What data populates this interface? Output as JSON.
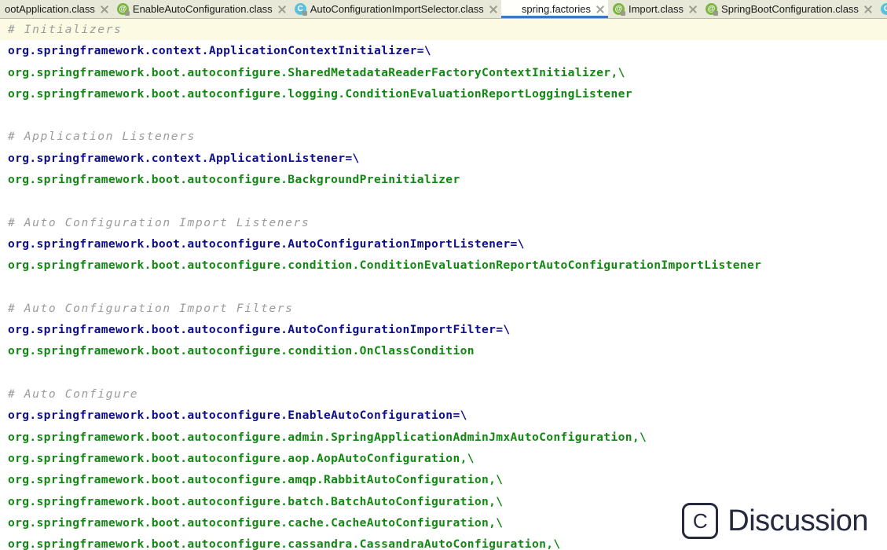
{
  "tabs": [
    {
      "label": "ootApplication.class",
      "icon": "annotation-icon",
      "icon_kind": "anno",
      "active": false,
      "truncated_left": true,
      "close_label": "×"
    },
    {
      "label": "EnableAutoConfiguration.class",
      "icon": "annotation-icon",
      "icon_kind": "anno",
      "active": false,
      "close_label": "×"
    },
    {
      "label": "AutoConfigurationImportSelector.class",
      "icon": "class-icon",
      "icon_kind": "class",
      "active": false,
      "close_label": "×"
    },
    {
      "label": "spring.factories",
      "icon": "spring-leaf-icon",
      "icon_kind": "leaf",
      "active": true,
      "close_label": "×"
    },
    {
      "label": "Import.class",
      "icon": "annotation-icon",
      "icon_kind": "anno",
      "active": false,
      "close_label": "×"
    },
    {
      "label": "SpringBootConfiguration.class",
      "icon": "annotation-icon",
      "icon_kind": "anno",
      "active": false,
      "close_label": "×"
    }
  ],
  "tab_icon_glyphs": {
    "anno": "@",
    "class": "C"
  },
  "colors": {
    "tabbar_background": "#e8e8d8",
    "active_tab_background": "#fffffb",
    "active_tab_underline": "#3b78c4",
    "editor_background": "#ffffff",
    "current_line_highlight": "#fcfae2",
    "comment": "#9b9b9b",
    "property_key": "#0e0e8c",
    "property_value": "#118811",
    "watermark": "#252a3d"
  },
  "editor": {
    "file_name": "spring.factories",
    "caret_line": 1,
    "caret_column": 1,
    "lines": [
      {
        "type": "comment",
        "text": "# Initializers",
        "highlight": true
      },
      {
        "type": "key",
        "text": "org.springframework.context.ApplicationContextInitializer=\\"
      },
      {
        "type": "value",
        "text": "org.springframework.boot.autoconfigure.SharedMetadataReaderFactoryContextInitializer,\\"
      },
      {
        "type": "value",
        "text": "org.springframework.boot.autoconfigure.logging.ConditionEvaluationReportLoggingListener"
      },
      {
        "type": "blank",
        "text": ""
      },
      {
        "type": "comment",
        "text": "# Application Listeners"
      },
      {
        "type": "key",
        "text": "org.springframework.context.ApplicationListener=\\"
      },
      {
        "type": "value",
        "text": "org.springframework.boot.autoconfigure.BackgroundPreinitializer"
      },
      {
        "type": "blank",
        "text": ""
      },
      {
        "type": "comment",
        "text": "# Auto Configuration Import Listeners"
      },
      {
        "type": "key",
        "text": "org.springframework.boot.autoconfigure.AutoConfigurationImportListener=\\"
      },
      {
        "type": "value",
        "text": "org.springframework.boot.autoconfigure.condition.ConditionEvaluationReportAutoConfigurationImportListener"
      },
      {
        "type": "blank",
        "text": ""
      },
      {
        "type": "comment",
        "text": "# Auto Configuration Import Filters"
      },
      {
        "type": "key",
        "text": "org.springframework.boot.autoconfigure.AutoConfigurationImportFilter=\\"
      },
      {
        "type": "value",
        "text": "org.springframework.boot.autoconfigure.condition.OnClassCondition"
      },
      {
        "type": "blank",
        "text": ""
      },
      {
        "type": "comment",
        "text": "# Auto Configure"
      },
      {
        "type": "key",
        "text": "org.springframework.boot.autoconfigure.EnableAutoConfiguration=\\"
      },
      {
        "type": "value",
        "text": "org.springframework.boot.autoconfigure.admin.SpringApplicationAdminJmxAutoConfiguration,\\"
      },
      {
        "type": "value",
        "text": "org.springframework.boot.autoconfigure.aop.AopAutoConfiguration,\\"
      },
      {
        "type": "value",
        "text": "org.springframework.boot.autoconfigure.amqp.RabbitAutoConfiguration,\\"
      },
      {
        "type": "value",
        "text": "org.springframework.boot.autoconfigure.batch.BatchAutoConfiguration,\\"
      },
      {
        "type": "value",
        "text": "org.springframework.boot.autoconfigure.cache.CacheAutoConfiguration,\\"
      },
      {
        "type": "value",
        "text": "org.springframework.boot.autoconfigure.cassandra.CassandraAutoConfiguration,\\"
      }
    ]
  },
  "watermark": {
    "logo_letter": "C",
    "text": "Discussion"
  }
}
